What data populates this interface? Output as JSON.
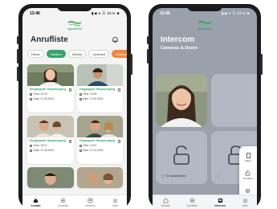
{
  "left_phone": {
    "status": {
      "time": "13:46",
      "icons": "▮◀ ▾ ☰ 91% ■"
    },
    "brand_name": "appcontrolo",
    "title": "Anrufliste",
    "filters": [
      "Heute",
      "Gestern",
      "Woche",
      "Lieferant",
      "Unbekannt"
    ],
    "cards": [
      {
        "name": "Eingangstür Haupteingang",
        "time": "Time: 10:29",
        "date": "Date: 17.03.2023"
      },
      {
        "name": "Eingangstür Haupteingang",
        "time": "Time: 10:29",
        "date": "Date: 17.03.2023"
      },
      {
        "name": "Eingangstür Haupteingang",
        "time": "Time: 10:07",
        "date": "Date: 17.03.2023"
      },
      {
        "name": "Eingangstür Haupteingang",
        "time": "Time: 10:07",
        "date": "Date: 17.03.2023"
      }
    ],
    "tabs": [
      "Kontakt",
      "Anrufliste",
      "Intercom",
      "Mehr"
    ]
  },
  "right_phone": {
    "status": {
      "time": "13:46",
      "icons": "▮◀ ▾ ☰ 91% ■"
    },
    "brand_name": "appcontrolo",
    "title": "Intercom",
    "subtitle": "Cameras & Doors",
    "unlock_label": "Tür aufschließen",
    "menu": [
      "Aktion",
      "Tür öffnen",
      "Konfiguration"
    ],
    "tabs": [
      "Kontakt",
      "Anrufliste",
      "Intercom",
      "Mehr"
    ]
  },
  "colors": {
    "brand_green": "#37a36a",
    "accent_orange": "#f0873a",
    "title_navy": "#1e2a3a"
  }
}
